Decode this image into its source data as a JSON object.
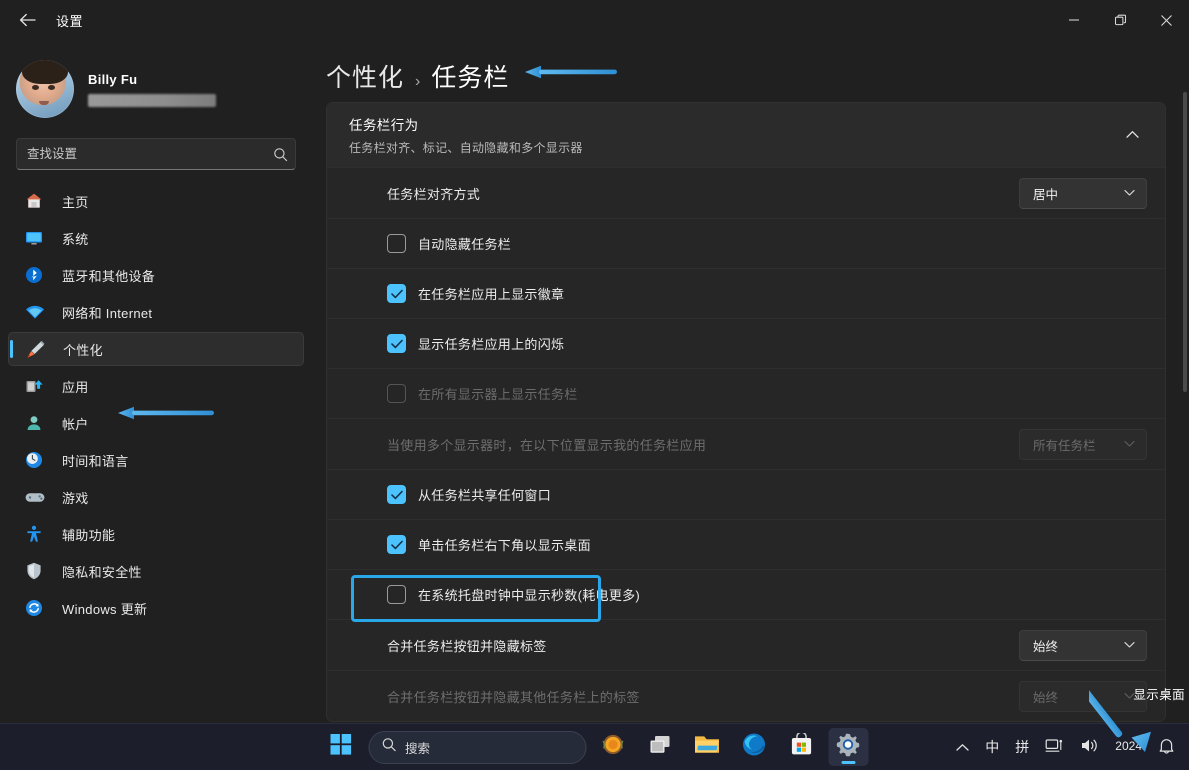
{
  "window": {
    "title": "设置",
    "back_icon": "back-arrow-icon",
    "controls": {
      "minimize": "minimize-icon",
      "maximize": "restore-icon",
      "close": "close-icon"
    }
  },
  "sidebar": {
    "profile": {
      "name": "Billy Fu",
      "email_redacted": ""
    },
    "search": {
      "placeholder": "查找设置",
      "value": "",
      "icon": "search-icon"
    },
    "items": [
      {
        "label": "主页",
        "icon": "home-icon",
        "active": false
      },
      {
        "label": "系统",
        "icon": "system-monitor-icon",
        "active": false
      },
      {
        "label": "蓝牙和其他设备",
        "icon": "bluetooth-icon",
        "active": false
      },
      {
        "label": "网络和 Internet",
        "icon": "wifi-icon",
        "active": false
      },
      {
        "label": "个性化",
        "icon": "personalization-brush-icon",
        "active": true
      },
      {
        "label": "应用",
        "icon": "apps-icon",
        "active": false
      },
      {
        "label": "帐户",
        "icon": "account-person-icon",
        "active": false
      },
      {
        "label": "时间和语言",
        "icon": "clock-icon",
        "active": false
      },
      {
        "label": "游戏",
        "icon": "gamepad-icon",
        "active": false
      },
      {
        "label": "辅助功能",
        "icon": "accessibility-person-icon",
        "active": false
      },
      {
        "label": "隐私和安全性",
        "icon": "shield-icon",
        "active": false
      },
      {
        "label": "Windows 更新",
        "icon": "update-refresh-icon",
        "active": false
      }
    ]
  },
  "main": {
    "breadcrumb": {
      "parent": "个性化",
      "separator": "›",
      "current": "任务栏"
    },
    "card": {
      "title": "任务栏行为",
      "subtitle": "任务栏对齐、标记、自动隐藏和多个显示器",
      "collapse_icon": "chevron-up-icon"
    },
    "rows": [
      {
        "type": "combo",
        "label": "任务栏对齐方式",
        "value": "居中",
        "disabled": false,
        "highlighted": false
      },
      {
        "type": "checkbox",
        "label": "自动隐藏任务栏",
        "checked": false,
        "disabled": false,
        "highlighted": false
      },
      {
        "type": "checkbox",
        "label": "在任务栏应用上显示徽章",
        "checked": true,
        "disabled": false,
        "highlighted": false
      },
      {
        "type": "checkbox",
        "label": "显示任务栏应用上的闪烁",
        "checked": true,
        "disabled": false,
        "highlighted": false
      },
      {
        "type": "checkbox",
        "label": "在所有显示器上显示任务栏",
        "checked": false,
        "disabled": true,
        "highlighted": false
      },
      {
        "type": "combo",
        "label": "当使用多个显示器时，在以下位置显示我的任务栏应用",
        "value": "所有任务栏",
        "disabled": true,
        "highlighted": false
      },
      {
        "type": "checkbox",
        "label": "从任务栏共享任何窗口",
        "checked": true,
        "disabled": false,
        "highlighted": false
      },
      {
        "type": "checkbox",
        "label": "单击任务栏右下角以显示桌面",
        "checked": true,
        "disabled": false,
        "highlighted": true
      },
      {
        "type": "checkbox",
        "label": "在系统托盘时钟中显示秒数(耗电更多)",
        "checked": false,
        "disabled": false,
        "highlighted": false
      },
      {
        "type": "combo",
        "label": "合并任务栏按钮并隐藏标签",
        "value": "始终",
        "disabled": false,
        "highlighted": false
      },
      {
        "type": "combo",
        "label": "合并任务栏按钮并隐藏其他任务栏上的标签",
        "value": "始终",
        "disabled": true,
        "highlighted": false
      }
    ]
  },
  "annotations": {
    "show_desktop_label": "显示桌面",
    "arrow_breadcrumb": "left-arrow-annotation",
    "arrow_sidebar": "left-arrow-annotation",
    "arrow_show_desktop": "diagonal-arrow-annotation"
  },
  "taskbar": {
    "start": "windows-start-icon",
    "search": {
      "label": "搜索",
      "icon": "search-icon"
    },
    "apps": [
      {
        "name": "copilot-icon",
        "active": false
      },
      {
        "name": "task-view-icon",
        "active": false
      },
      {
        "name": "file-explorer-icon",
        "active": false
      },
      {
        "name": "edge-browser-icon",
        "active": false
      },
      {
        "name": "microsoft-store-icon",
        "active": false
      },
      {
        "name": "settings-gear-icon",
        "active": true
      }
    ],
    "tray": {
      "overflow": "chevron-up-icon",
      "ime_mode": "中",
      "ime_pinyin": "拼",
      "network": "network-icon",
      "volume": "volume-icon",
      "clock": "2024",
      "notifications": "bell-icon"
    }
  },
  "colors": {
    "accent": "#4cc2ff",
    "highlight_border": "#2aa7e8",
    "window_bg": "#202020",
    "card_bg": "#272727",
    "taskbar_bg": "#1c1f2b"
  }
}
